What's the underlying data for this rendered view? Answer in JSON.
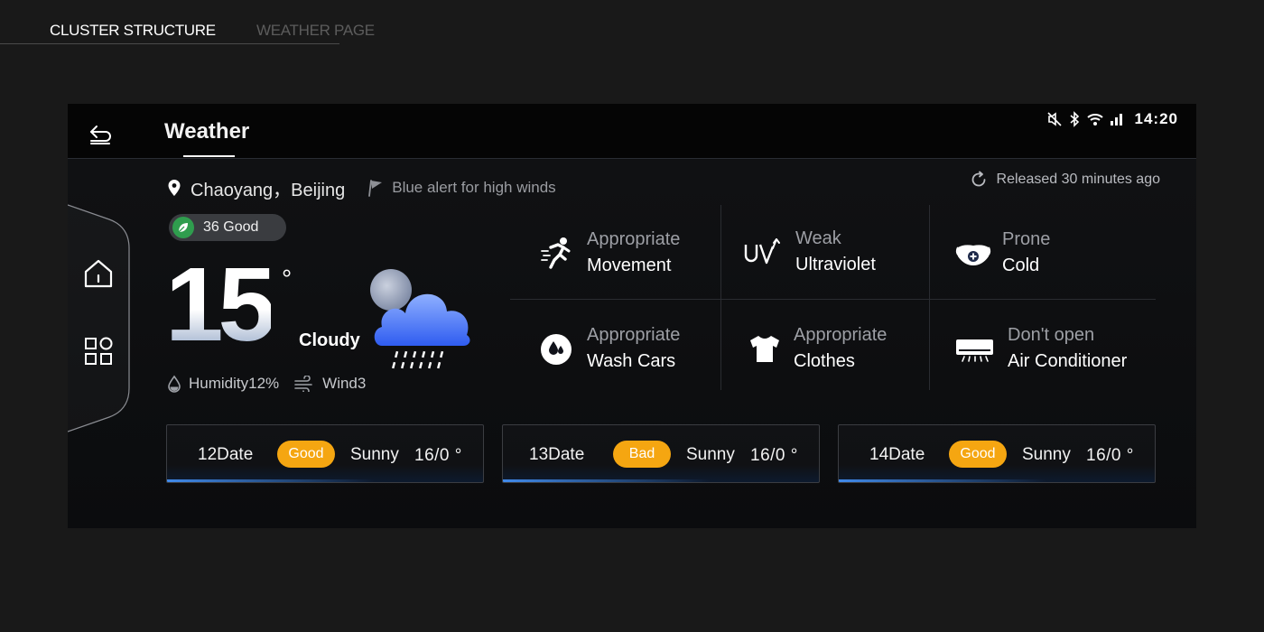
{
  "top_tabs": {
    "active": "CLUSTER STRUCTURE",
    "inactive": "WEATHER PAGE"
  },
  "header": {
    "title": "Weather",
    "time": "14:20"
  },
  "location": {
    "text": "Chaoyang，Beijing",
    "alert": "Blue alert for high winds",
    "released": "Released 30 minutes ago"
  },
  "aqi": {
    "label": "36 Good"
  },
  "current": {
    "temperature": "15",
    "degree_symbol": "°",
    "condition": "Cloudy",
    "humidity": "Humidity12%",
    "wind": "Wind3"
  },
  "indices": [
    {
      "line1": "Appropriate",
      "line2": "Movement",
      "icon": "running-icon"
    },
    {
      "line1": "Weak",
      "line2": "Ultraviolet",
      "icon": "uv-icon"
    },
    {
      "line1": "Prone",
      "line2": "Cold",
      "icon": "mask-icon"
    },
    {
      "line1": "Appropriate",
      "line2": "Wash Cars",
      "icon": "water-drop-icon"
    },
    {
      "line1": "Appropriate",
      "line2": "Clothes",
      "icon": "tshirt-icon"
    },
    {
      "line1": "Don't open",
      "line2": "Air Conditioner",
      "icon": "air-conditioner-icon"
    }
  ],
  "forecast": [
    {
      "date": "12Date",
      "quality": "Good",
      "condition": "Sunny",
      "range": "16/0 °"
    },
    {
      "date": "13Date",
      "quality": "Bad",
      "condition": "Sunny",
      "range": "16/0 °"
    },
    {
      "date": "14Date",
      "quality": "Good",
      "condition": "Sunny",
      "range": "16/0 °"
    }
  ],
  "colors": {
    "background": "#191919",
    "badge": "#f5a611",
    "aqi_leaf": "#2f9d4e",
    "accent_blue": "#4696ff"
  }
}
